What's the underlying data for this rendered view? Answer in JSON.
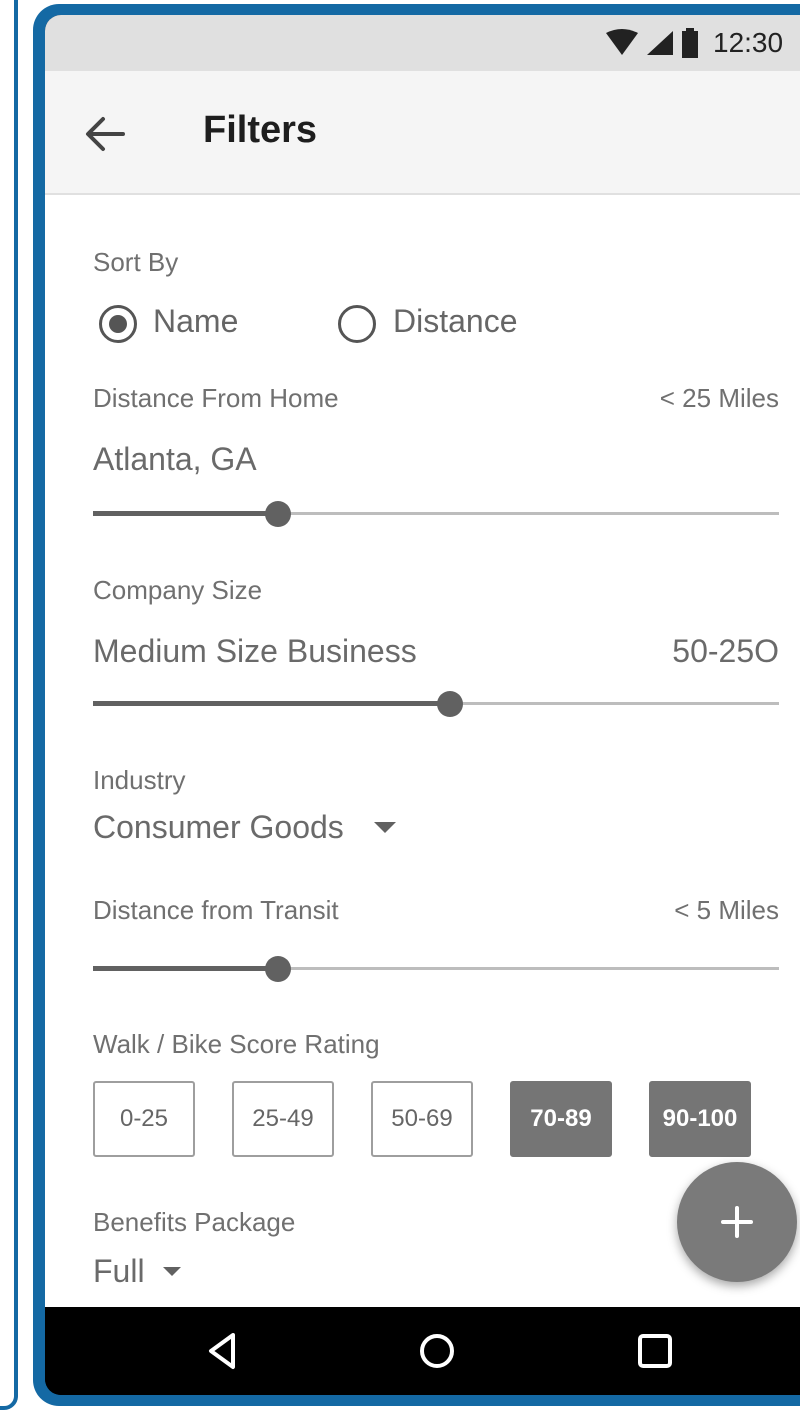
{
  "status_bar": {
    "time": "12:30",
    "icons": [
      "wifi-icon",
      "cell-signal-icon",
      "battery-icon"
    ]
  },
  "app_bar": {
    "title": "Filters",
    "back_icon": "arrow-left-icon"
  },
  "sort_by": {
    "label": "Sort By",
    "options": [
      {
        "label": "Name",
        "selected": true
      },
      {
        "label": "Distance",
        "selected": false
      }
    ]
  },
  "distance_from_home": {
    "label": "Distance From Home",
    "value_label": "< 25 Miles",
    "location": "Atlanta, GA",
    "slider_fraction": 0.27
  },
  "company_size": {
    "label": "Company Size",
    "value": "Medium Size Business",
    "range": "50-25O",
    "slider_fraction": 0.52
  },
  "industry": {
    "label": "Industry",
    "selected": "Consumer Goods"
  },
  "distance_from_transit": {
    "label": "Distance from Transit",
    "value_label": "< 5 Miles",
    "slider_fraction": 0.27
  },
  "walk_bike": {
    "label": "Walk / Bike Score Rating",
    "options": [
      {
        "label": "0-25",
        "selected": false
      },
      {
        "label": "25-49",
        "selected": false
      },
      {
        "label": "50-69",
        "selected": false
      },
      {
        "label": "70-89",
        "selected": true
      },
      {
        "label": "90-100",
        "selected": true
      }
    ]
  },
  "benefits": {
    "label": "Benefits Package",
    "selected": "Full"
  },
  "fab": {
    "icon": "plus-icon"
  },
  "nav_bar": {
    "icons": [
      "back-triangle-icon",
      "home-circle-icon",
      "recents-square-icon"
    ]
  },
  "colors": {
    "frame": "#1469a4",
    "chip_selected": "#757575",
    "fab": "#7a7a7a"
  }
}
